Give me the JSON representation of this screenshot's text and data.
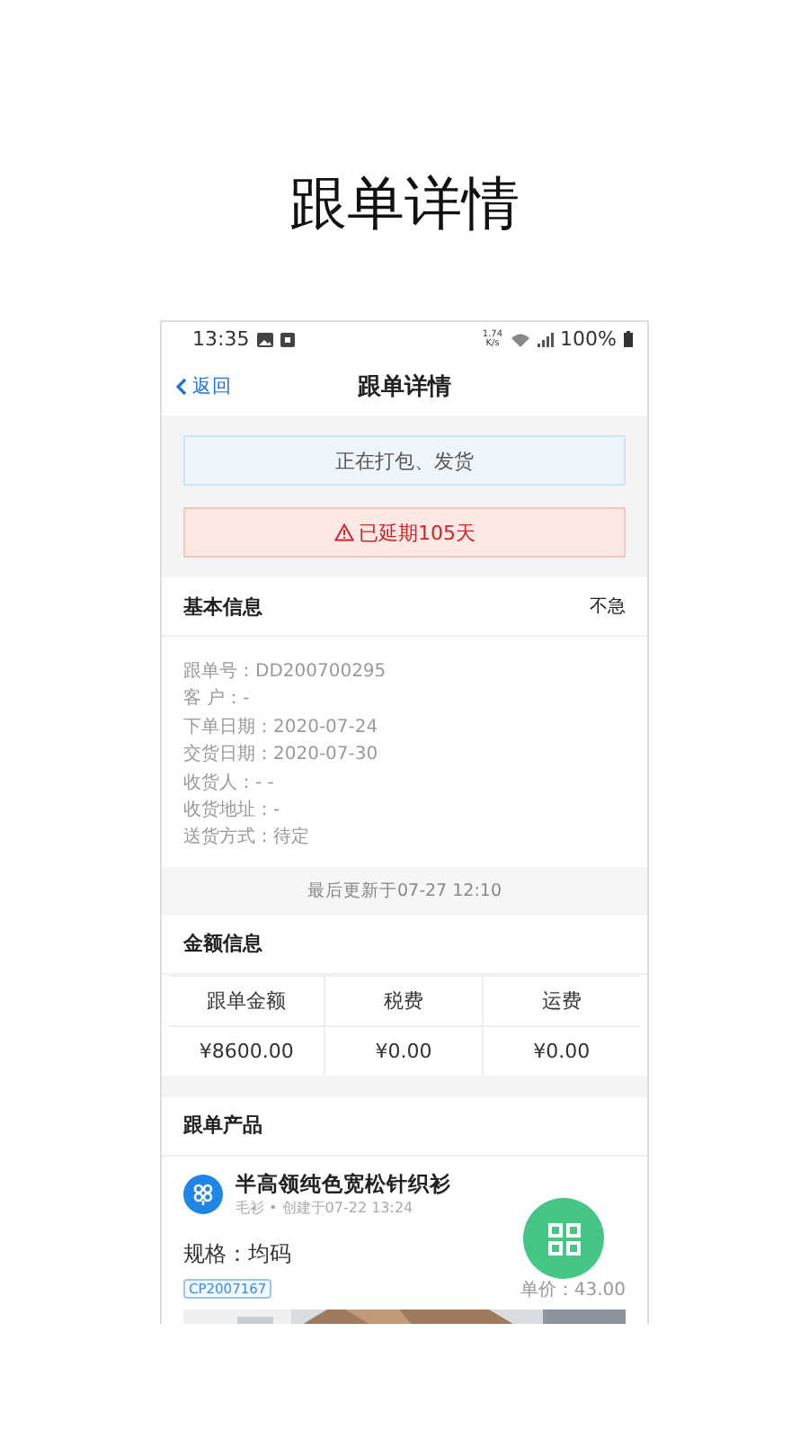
{
  "page_title": "跟单详情",
  "status_bar": {
    "time": "13:35",
    "speed": "1.74\nK/s",
    "battery": "100%"
  },
  "nav": {
    "back": "返回",
    "title": "跟单详情"
  },
  "banners": [
    {
      "kind": "info",
      "text": "正在打包、发货"
    },
    {
      "kind": "warning",
      "text": "已延期105天"
    }
  ],
  "basic_info": {
    "title": "基本信息",
    "urgency": "不急",
    "fields": [
      "跟单号：DD200700295",
      "客 户：-",
      "下单日期：2020-07-24",
      "交货日期：2020-07-30",
      "收货人：-  -",
      "收货地址：-",
      "送货方式：待定"
    ],
    "updated": "最后更新于07-27 12:10"
  },
  "amount_info": {
    "title": "金额信息",
    "columns": [
      "跟单金额",
      "税费",
      "运费"
    ],
    "values": [
      "¥8600.00",
      "¥0.00",
      "¥0.00"
    ]
  },
  "products": {
    "title": "跟单产品",
    "items": [
      {
        "name": "半高领纯色宽松针织衫",
        "meta": "毛衫 • 创建于07-22 13:24",
        "spec": "规格：均码",
        "code": "CP2007167",
        "price": "单价：43.00"
      }
    ]
  }
}
